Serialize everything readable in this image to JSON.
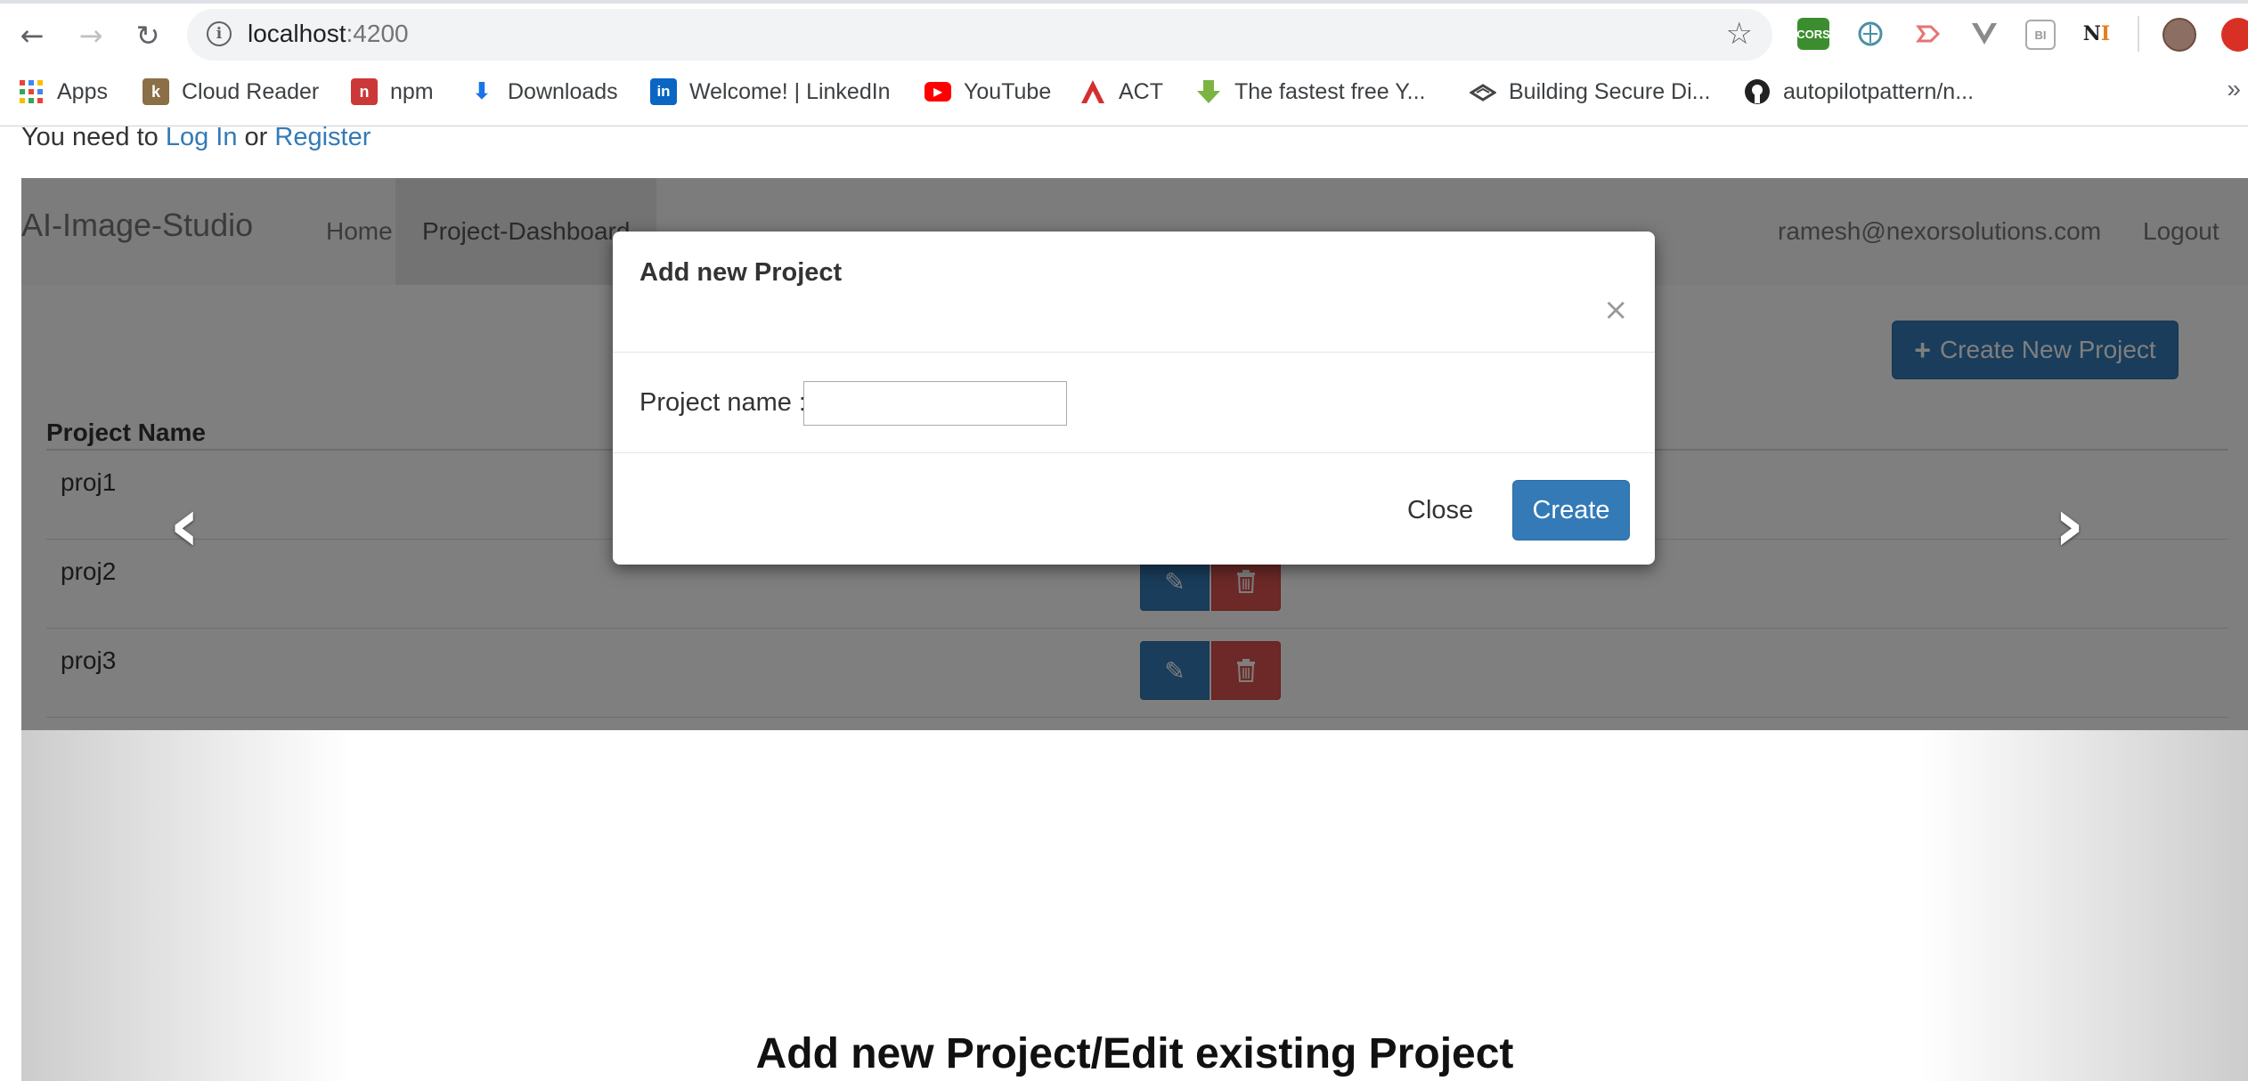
{
  "browser": {
    "url_host": "localhost",
    "url_port": ":4200",
    "extensions": [
      "cors-extension-icon",
      "vpn-extension-icon",
      "arrow-extension-icon",
      "vue-extension-icon",
      "bi-extension-icon",
      "ni-extension-icon"
    ],
    "bookmarks": [
      {
        "label": "Apps",
        "icon": "apps-grid-icon"
      },
      {
        "label": "Cloud Reader",
        "icon": "kindle-icon"
      },
      {
        "label": "npm",
        "icon": "npm-icon"
      },
      {
        "label": "Downloads",
        "icon": "download-icon"
      },
      {
        "label": "Welcome! | LinkedIn",
        "icon": "linkedin-icon"
      },
      {
        "label": "YouTube",
        "icon": "youtube-icon"
      },
      {
        "label": "ACT",
        "icon": "act-icon"
      },
      {
        "label": "The fastest free Y...",
        "icon": "download-arrow-icon"
      },
      {
        "label": "Building Secure Di...",
        "icon": "building-icon"
      },
      {
        "label": "autopilotpattern/n...",
        "icon": "github-icon"
      }
    ],
    "more": "»"
  },
  "auth": {
    "prefix": "You need to",
    "login": "Log In",
    "or": "or",
    "register": "Register"
  },
  "navbar": {
    "brand": "AI-Image-Studio",
    "home": "Home",
    "dashboard": "Project-Dashboard",
    "user_email": "ramesh@nexorsolutions.com",
    "logout": "Logout"
  },
  "dashboard": {
    "create_button": "Create New Project",
    "column_header": "Project Name",
    "projects": [
      "proj1",
      "proj2",
      "proj3"
    ]
  },
  "carousel": {
    "caption": "Add new Project/Edit existing Project",
    "prev": "‹",
    "next": "›"
  },
  "modal": {
    "title": "Add new Project",
    "close_x": "×",
    "label": "Project name :",
    "input_value": "",
    "close_button": "Close",
    "create_button": "Create"
  },
  "colors": {
    "primary": "#337ab7",
    "danger": "#d9534f",
    "link": "#337ab7"
  }
}
